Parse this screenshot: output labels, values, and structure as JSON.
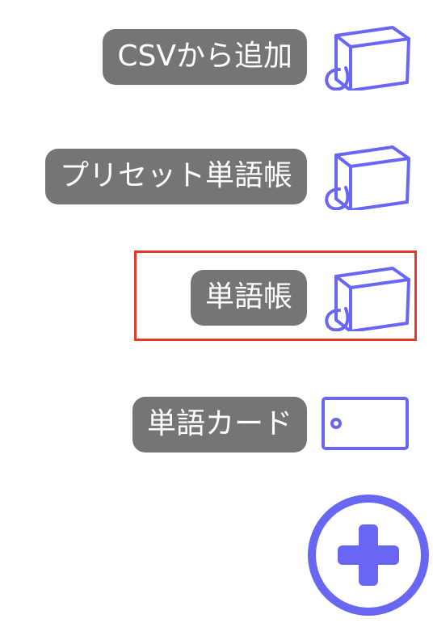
{
  "menu": {
    "csv_add": {
      "label": "CSVから追加",
      "icon": "wordbook-ring-icon"
    },
    "preset_wordbook": {
      "label": "プリセット単語帳",
      "icon": "wordbook-ring-icon"
    },
    "wordbook": {
      "label": "単語帳",
      "icon": "wordbook-ring-icon",
      "selected": true
    },
    "word_card": {
      "label": "単語カード",
      "icon": "word-card-icon"
    }
  },
  "fab": {
    "icon": "plus-icon"
  },
  "colors": {
    "accent": "#6a66f4",
    "pill_bg": "#757575",
    "pill_text": "#ffffff",
    "selection_border": "#e53a2a"
  }
}
